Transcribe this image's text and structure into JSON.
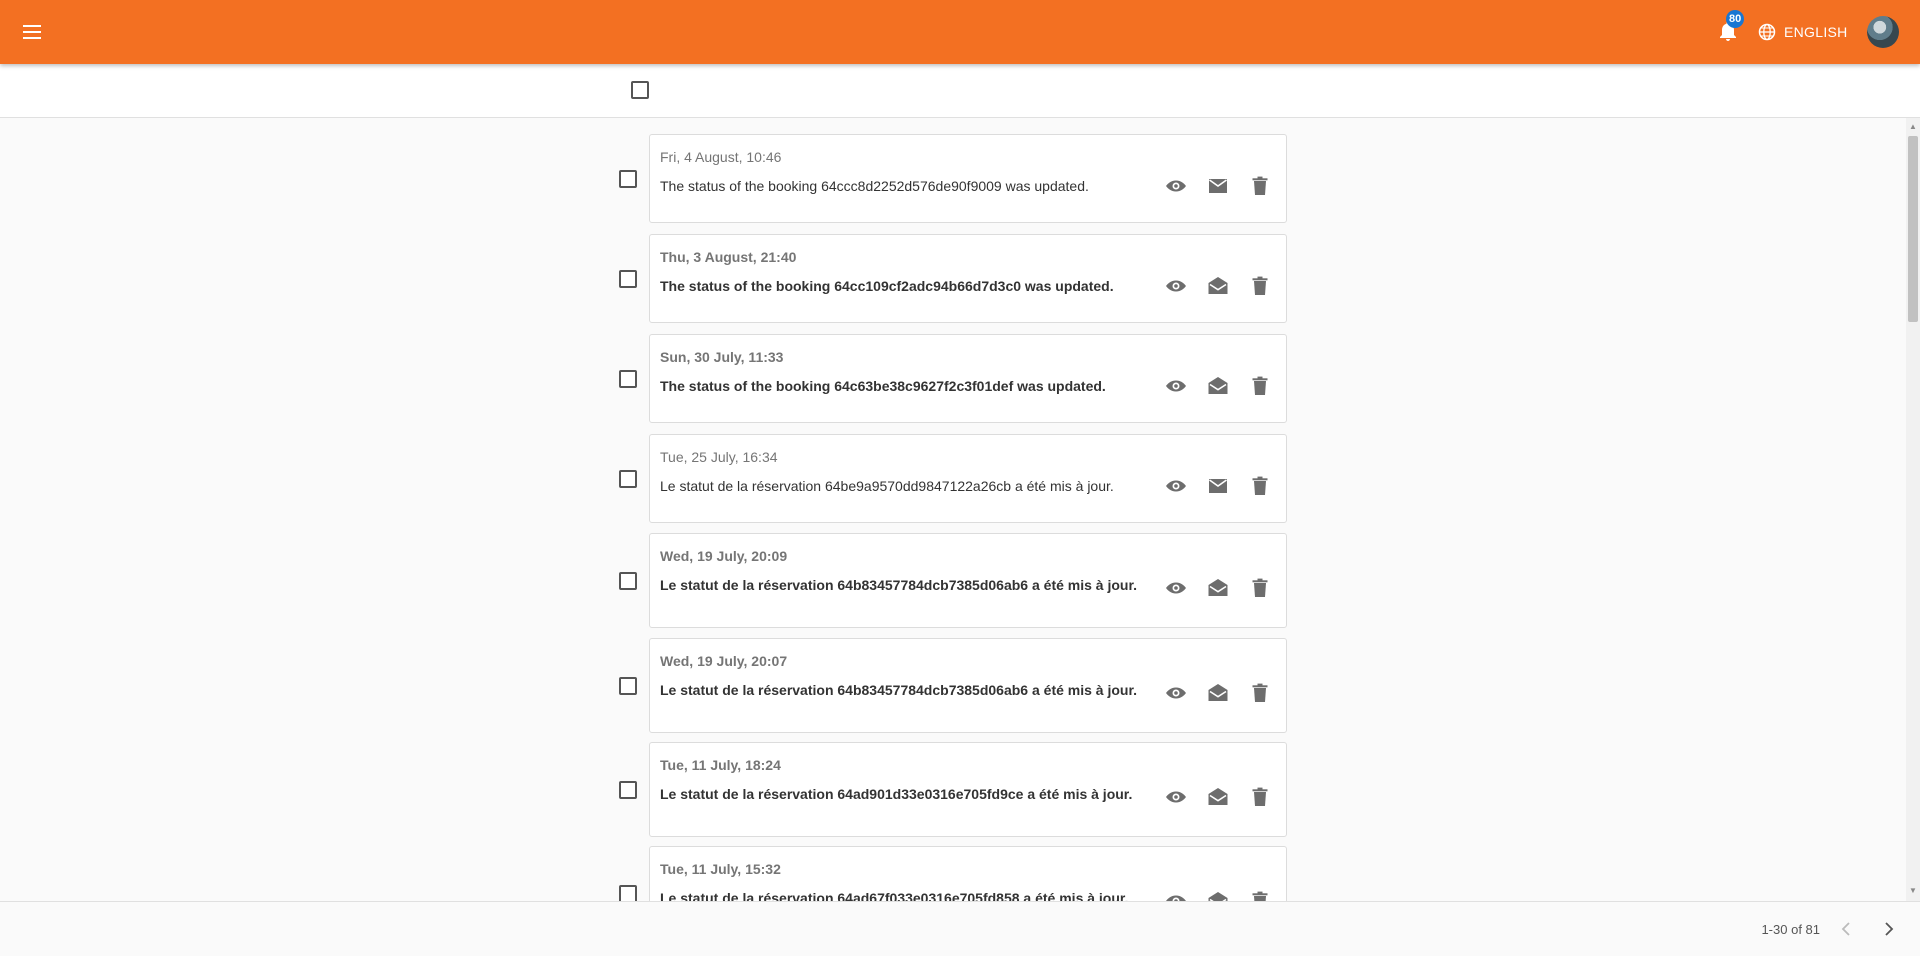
{
  "header": {
    "notification_count": "80",
    "language_label": "ENGLISH",
    "brand_color": "#f37022",
    "badge_color": "#1976d2"
  },
  "notifications": [
    {
      "date": "Fri, 4 August, 10:46",
      "message": "The status of the booking 64ccc8d2252d576de90f9009 was updated.",
      "read": true
    },
    {
      "date": "Thu, 3 August, 21:40",
      "message": "The status of the booking 64cc109cf2adc94b66d7d3c0 was updated.",
      "read": false
    },
    {
      "date": "Sun, 30 July, 11:33",
      "message": "The status of the booking 64c63be38c9627f2c3f01def was updated.",
      "read": false
    },
    {
      "date": "Tue, 25 July, 16:34",
      "message": "Le statut de la réservation 64be9a9570dd9847122a26cb a été mis à jour.",
      "read": true
    },
    {
      "date": "Wed, 19 July, 20:09",
      "message": "Le statut de la réservation 64b83457784dcb7385d06ab6 a été mis à jour.",
      "read": false
    },
    {
      "date": "Wed, 19 July, 20:07",
      "message": "Le statut de la réservation 64b83457784dcb7385d06ab6 a été mis à jour.",
      "read": false
    },
    {
      "date": "Tue, 11 July, 18:24",
      "message": "Le statut de la réservation 64ad901d33e0316e705fd9ce a été mis à jour.",
      "read": false
    },
    {
      "date": "Tue, 11 July, 15:32",
      "message": "Le statut de la réservation 64ad67f033e0316e705fd858 a été mis à jour.",
      "read": false
    }
  ],
  "pagination": {
    "range_label": "1-30 of 81"
  },
  "icons": {
    "view": "eye-icon",
    "mark_unread": "mail-icon",
    "mark_read": "mail-open-icon",
    "delete": "trash-icon"
  }
}
